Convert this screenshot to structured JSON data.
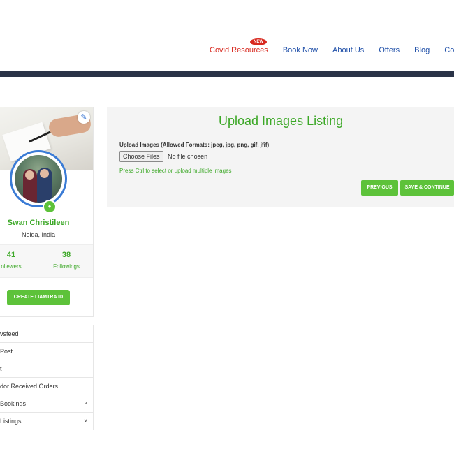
{
  "nav": {
    "items": [
      {
        "label": "Covid Resources",
        "badge": "NEW"
      },
      {
        "label": "Book Now"
      },
      {
        "label": "About Us"
      },
      {
        "label": "Offers"
      },
      {
        "label": "Blog"
      },
      {
        "label": "Cont"
      }
    ]
  },
  "profile": {
    "name": "Swan Christileen",
    "location": "Noida, India",
    "followers_count": "41",
    "followers_label": "ollewers",
    "followings_count": "38",
    "followings_label": "Followings",
    "create_button": "CREATE LIAMTRA ID"
  },
  "menu": {
    "items": [
      {
        "label": "vsfeed"
      },
      {
        "label": "Post"
      },
      {
        "label": "t"
      },
      {
        "label": "dor Received Orders"
      },
      {
        "label": "Bookings",
        "chevron": "˅"
      },
      {
        "label": "Listings",
        "chevron": "˅"
      }
    ]
  },
  "upload": {
    "title": "Upload Images Listing",
    "formats_label": "Upload Images (Allowed Formats: jpeg, jpg, png, gif, jfif)",
    "choose_button": "Choose Files",
    "file_status": "No file chosen",
    "hint": "Press Ctrl to select or upload multiple images",
    "previous_button": "PREVIOUS",
    "save_button": "SAVE & CONTINUE"
  },
  "icons": {
    "edit": "edit-icon",
    "camera": "camera-icon",
    "chevron": "chevron-down-icon"
  },
  "colors": {
    "brand_green": "#5dc23a",
    "text_green": "#3ca827",
    "nav_blue": "#1f4fa8",
    "covid_red": "#d8281e",
    "nav_strip": "#2a3347"
  }
}
